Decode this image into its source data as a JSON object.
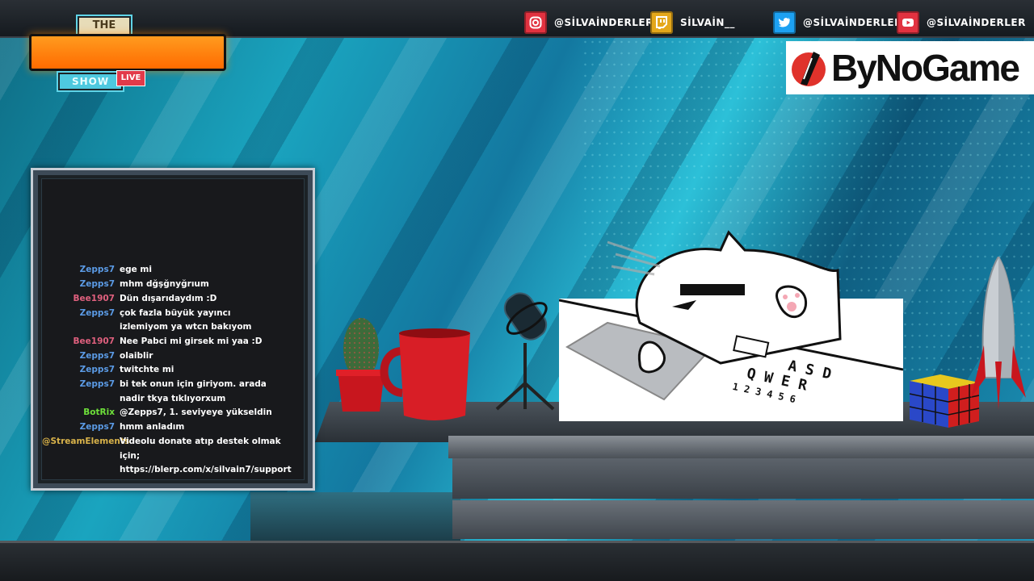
{
  "header": {
    "socials": [
      {
        "platform": "instagram",
        "icon": "instagram-icon",
        "color": "#e13240",
        "handle": "@SİLVAİNDERLER"
      },
      {
        "platform": "twitch",
        "icon": "twitch-icon",
        "color": "#e4a71b",
        "handle": "SİLVAİN__"
      },
      {
        "platform": "twitter",
        "icon": "twitter-icon",
        "color": "#1da1f2",
        "handle": "@SİLVAİNDERLEI"
      },
      {
        "platform": "youtube",
        "icon": "youtube-icon",
        "color": "#e13240",
        "handle": "@SİLVAİNDERLER"
      }
    ]
  },
  "logo": {
    "the": "THE",
    "show": "SHOW",
    "live": "LIVE",
    "bar_color": "#ff8a00"
  },
  "sponsor": {
    "name": "ByNoGame",
    "mark_color": "#e0322b"
  },
  "chat": {
    "messages": [
      {
        "user": "Zepps7",
        "color": "#5b9be6",
        "text": "ege mi"
      },
      {
        "user": "Zepps7",
        "color": "#5b9be6",
        "text": "mhm dğşğnyğrıum"
      },
      {
        "user": "Bee1907",
        "color": "#e0607e",
        "text": "Dün dışarıdaydım :D"
      },
      {
        "user": "Zepps7",
        "color": "#5b9be6",
        "text": "çok fazla büyük yayıncı izlemiyom ya wtcn bakıyom"
      },
      {
        "user": "Bee1907",
        "color": "#e0607e",
        "text": "Nee Pabci mi girsek mi yaa :D"
      },
      {
        "user": "Zepps7",
        "color": "#5b9be6",
        "text": "olaiblir"
      },
      {
        "user": "Zepps7",
        "color": "#5b9be6",
        "text": "twitchte mi"
      },
      {
        "user": "Zepps7",
        "color": "#5b9be6",
        "text": "bi tek onun için giriyom. arada nadir tkya tıklıyorxum"
      },
      {
        "user": "BotRix",
        "color": "#6ee03a",
        "text": "@Zepps7, 1. seviyeye yükseldin"
      },
      {
        "user": "Zepps7",
        "color": "#5b9be6",
        "text": "hmm anladım"
      },
      {
        "user": "@StreamElements",
        "color": "#d8b24a",
        "text": "Videolu donate atıp destek olmak için; https://blerp.com/x/silvain7/support"
      }
    ]
  },
  "meme": {
    "keys_row1": "A S D",
    "keys_row2": "Q W E R",
    "keys_row3": "1 2 3 4 5 6"
  }
}
